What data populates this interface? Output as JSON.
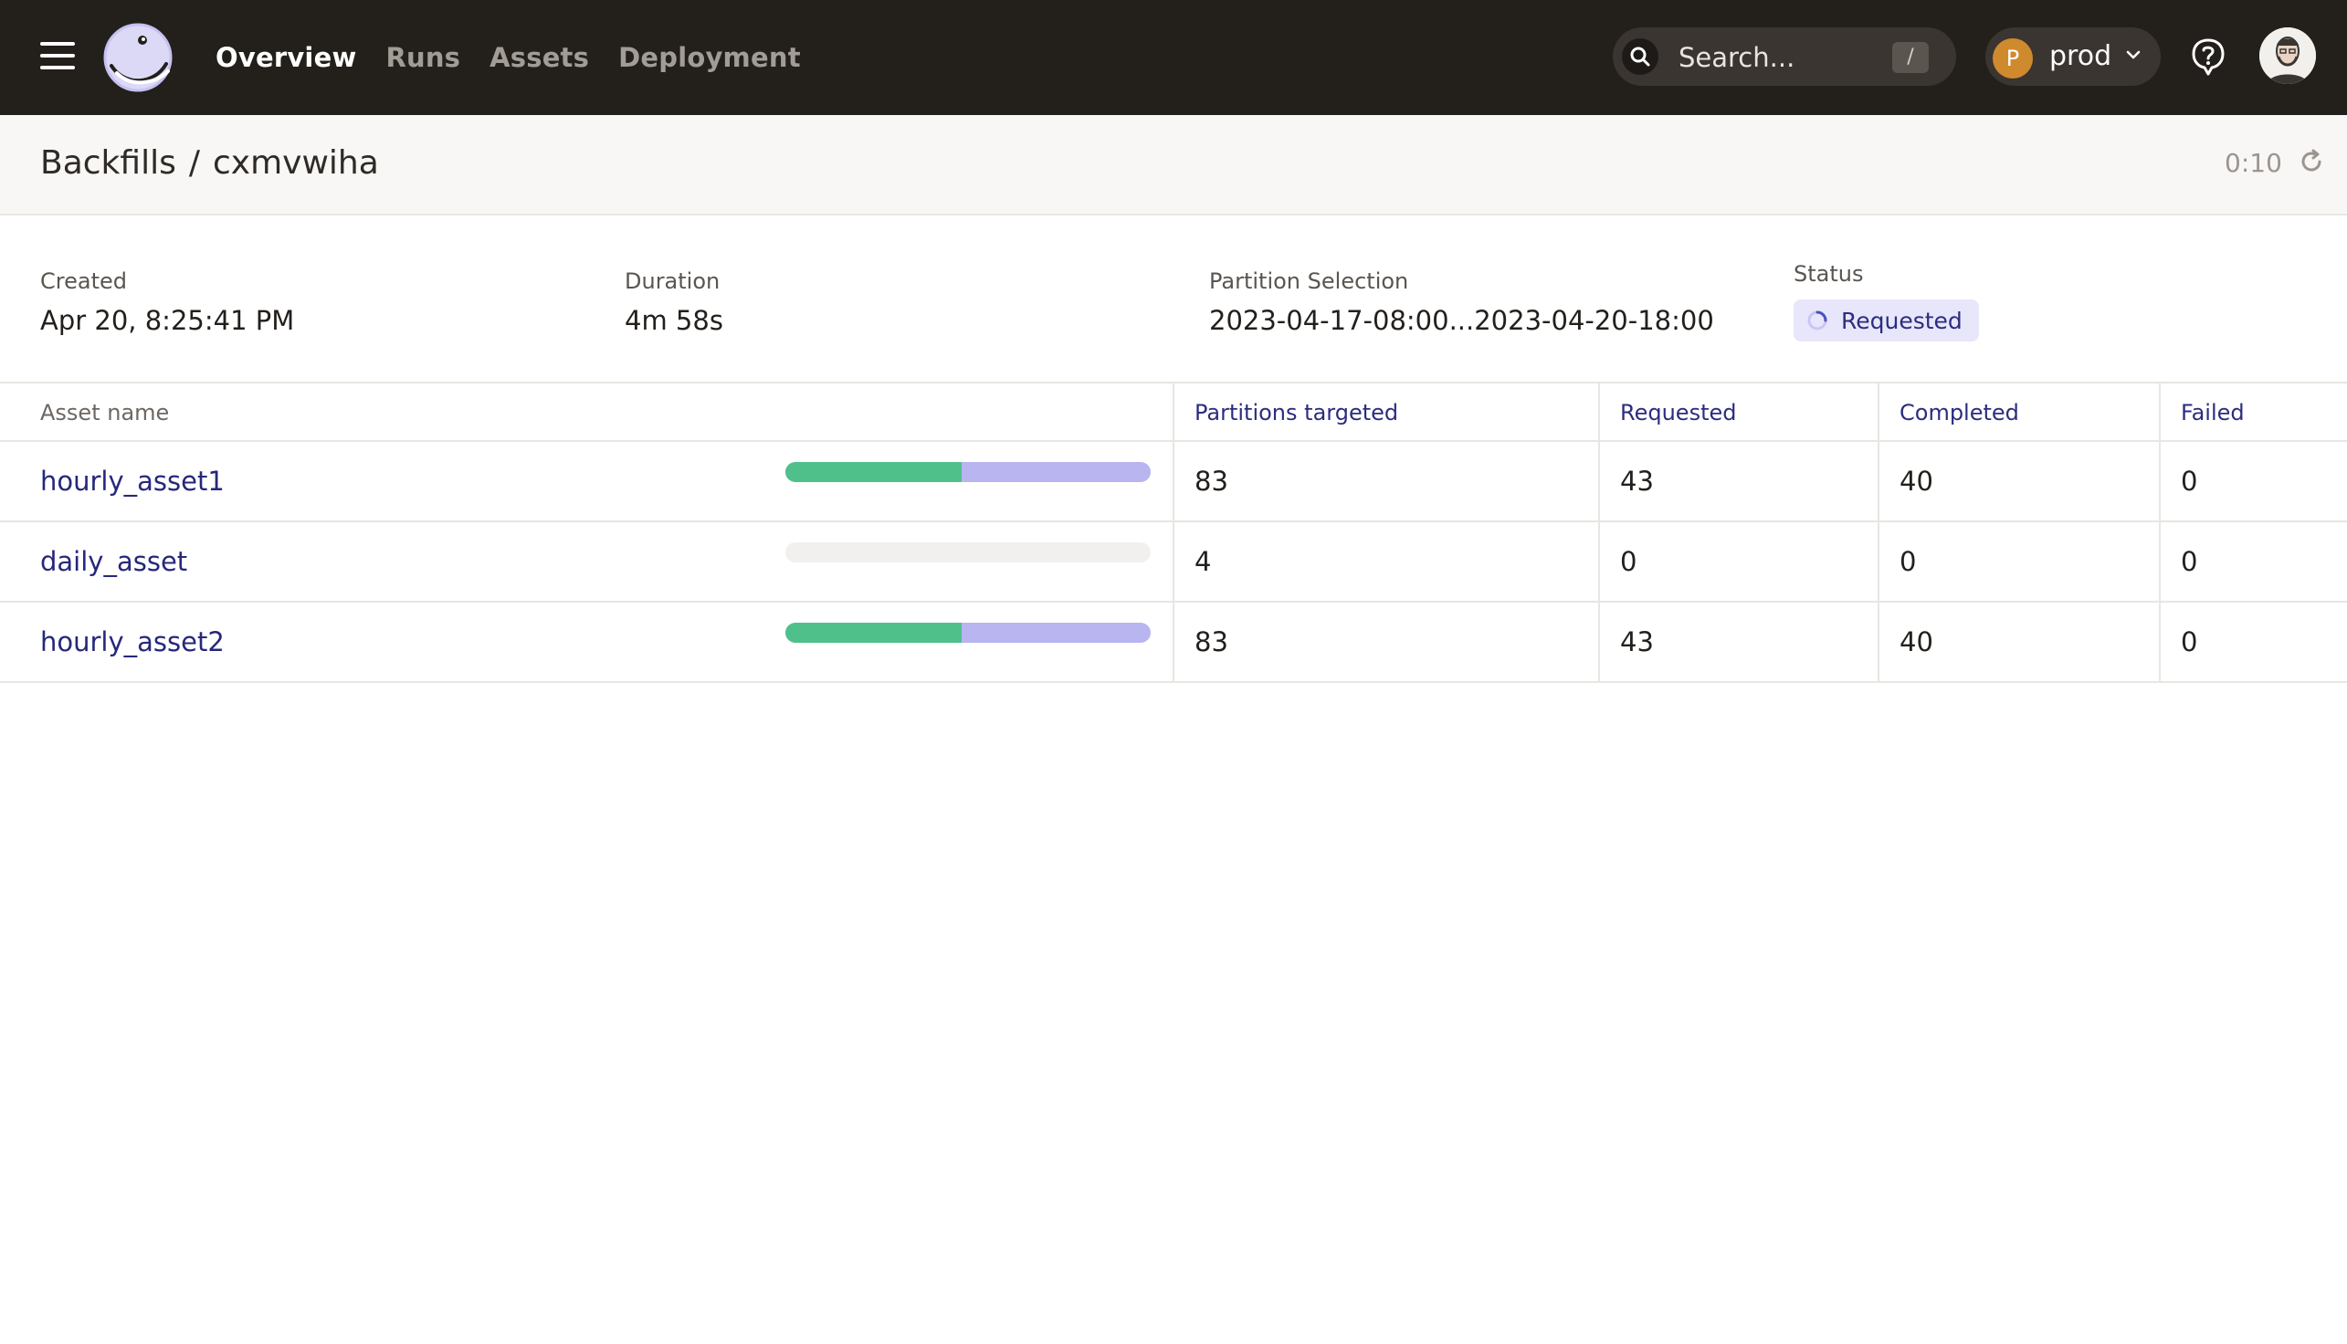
{
  "nav": {
    "links": [
      "Overview",
      "Runs",
      "Assets",
      "Deployment"
    ],
    "search_placeholder": "Search...",
    "search_shortcut": "/",
    "deployment_initial": "P",
    "deployment_name": "prod"
  },
  "page": {
    "breadcrumb_parent": "Backfills",
    "breadcrumb_sep": "/",
    "backfill_id": "cxmvwiha",
    "timer": "0:10"
  },
  "summary": {
    "created_label": "Created",
    "created_value": "Apr 20, 8:25:41 PM",
    "duration_label": "Duration",
    "duration_value": "4m 58s",
    "partition_label": "Partition Selection",
    "partition_value": "2023-04-17-08:00...2023-04-20-18:00",
    "status_label": "Status",
    "status_value": "Requested"
  },
  "table": {
    "headers": {
      "asset": "Asset name",
      "targeted": "Partitions targeted",
      "requested": "Requested",
      "completed": "Completed",
      "failed": "Failed"
    },
    "rows": [
      {
        "asset": "hourly_asset1",
        "targeted": "83",
        "requested": "43",
        "completed": "40",
        "failed": "0",
        "progress_completed_frac": 0.482,
        "progress_requested_frac": 0.518
      },
      {
        "asset": "daily_asset",
        "targeted": "4",
        "requested": "0",
        "completed": "0",
        "failed": "0",
        "progress_completed_frac": 0,
        "progress_requested_frac": 0
      },
      {
        "asset": "hourly_asset2",
        "targeted": "83",
        "requested": "43",
        "completed": "40",
        "failed": "0",
        "progress_completed_frac": 0.482,
        "progress_requested_frac": 0.518
      }
    ]
  },
  "colors": {
    "nav_bg": "#231f1b",
    "link_accent": "#25287a",
    "progress_completed": "#4fc08a",
    "progress_requested": "#b8b5f0",
    "status_badge_bg": "#e7e6fb"
  },
  "icons": [
    "menu-icon",
    "dagster-logo",
    "search-icon",
    "chevron-down-icon",
    "help-icon",
    "user-avatar",
    "refresh-icon",
    "spinner-icon"
  ]
}
